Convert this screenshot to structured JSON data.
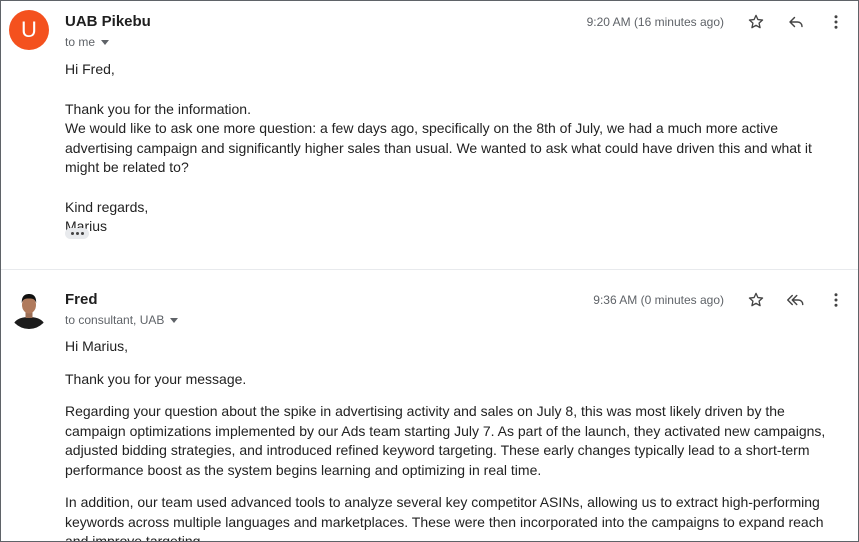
{
  "messages": [
    {
      "avatar_letter": "U",
      "avatar_color": "#f4511e",
      "sender": "UAB Pikebu",
      "recipients": "to me",
      "time": "9:20 AM (16 minutes ago)",
      "icons": [
        "star-icon",
        "reply-icon",
        "more-vert-icon"
      ],
      "body": {
        "greeting": "Hi Fred,",
        "line1": "Thank you for the information.",
        "line2": "We would like to ask one more question: a few days ago, specifically on the 8th of July, we had a much more active advertising campaign and significantly higher sales than usual. We wanted to ask what could have driven this and what it might be related to?",
        "closing": "Kind regards,",
        "signature": "Marius"
      }
    },
    {
      "avatar": "profile-photo",
      "sender": "Fred",
      "recipients": "to consultant, UAB",
      "time": "9:36 AM (0 minutes ago)",
      "icons": [
        "star-icon",
        "reply-all-icon",
        "more-vert-icon"
      ],
      "body": {
        "greeting": "Hi Marius,",
        "p1": "Thank you for your message.",
        "p2": "Regarding your question about the spike in advertising activity and sales on July 8, this was most likely driven by the campaign optimizations implemented by our Ads team starting July 7. As part of the launch, they activated new campaigns, adjusted bidding strategies, and introduced refined keyword targeting. These early changes typically lead to a short-term performance boost as the system begins learning and optimizing in real time.",
        "p3": "In addition, our team used advanced tools to analyze several key competitor ASINs, allowing us to extract high-performing keywords across multiple languages and marketplaces. These were then incorporated into the campaigns to expand reach and improve targeting."
      }
    }
  ]
}
